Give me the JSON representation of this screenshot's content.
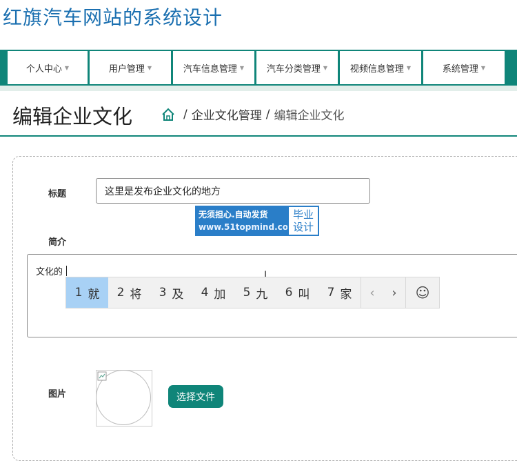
{
  "site": {
    "title": "红旗汽车网站的系统设计"
  },
  "nav": {
    "items": [
      {
        "label": "个人中心"
      },
      {
        "label": "用户管理"
      },
      {
        "label": "汽车信息管理"
      },
      {
        "label": "汽车分类管理"
      },
      {
        "label": "视频信息管理"
      },
      {
        "label": "系统管理"
      }
    ],
    "caret_icon": "caret-down-icon"
  },
  "page": {
    "title": "编辑企业文化",
    "breadcrumb": {
      "home_icon": "home-icon",
      "separator": "/",
      "items": [
        "企业文化管理",
        "编辑企业文化"
      ]
    }
  },
  "form": {
    "title_label": "标题",
    "title_value": "这里是发布企业文化的地方",
    "summary_label": "简介",
    "summary_value": "文化的",
    "image_label": "图片",
    "choose_file_label": "选择文件"
  },
  "watermark": {
    "line1": "无须担心.自动发货",
    "line2": "www.51topmind.com",
    "badge_line1": "毕业",
    "badge_line2": "设计"
  },
  "ime": {
    "candidates": [
      {
        "num": "1",
        "char": "就"
      },
      {
        "num": "2",
        "char": "将"
      },
      {
        "num": "3",
        "char": "及"
      },
      {
        "num": "4",
        "char": "加"
      },
      {
        "num": "5",
        "char": "九"
      },
      {
        "num": "6",
        "char": "叫"
      },
      {
        "num": "7",
        "char": "家"
      }
    ],
    "prev": "‹",
    "next": "›",
    "emoji": "☺"
  },
  "colors": {
    "accent": "#0f8579",
    "title_blue": "#1a6fb0",
    "ime_selected": "#a8d1f5"
  }
}
